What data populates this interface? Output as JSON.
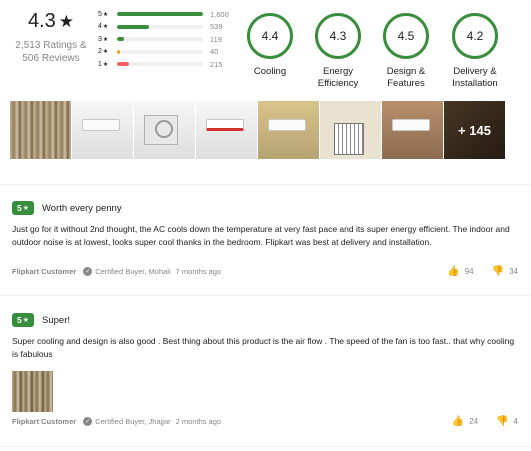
{
  "summary": {
    "average": "4.3",
    "star": "★",
    "ratings_count": "2,513 Ratings &",
    "reviews_count": "506 Reviews"
  },
  "distribution": [
    {
      "label": "5",
      "count": "1,600",
      "fraction": 1.0,
      "color": "#388e3c"
    },
    {
      "label": "4",
      "count": "539",
      "fraction": 0.37,
      "color": "#388e3c"
    },
    {
      "label": "3",
      "count": "119",
      "fraction": 0.08,
      "color": "#388e3c"
    },
    {
      "label": "2",
      "count": "40",
      "fraction": 0.03,
      "color": "#ff9f00"
    },
    {
      "label": "1",
      "count": "215",
      "fraction": 0.14,
      "color": "#ff6161"
    }
  ],
  "feature_ratings": [
    {
      "value": "4.4",
      "name_line1": "Cooling",
      "name_line2": ""
    },
    {
      "value": "4.3",
      "name_line1": "Energy",
      "name_line2": "Efficiency"
    },
    {
      "value": "4.5",
      "name_line1": "Design &",
      "name_line2": "Features"
    },
    {
      "value": "4.2",
      "name_line1": "Delivery &",
      "name_line2": "Installation"
    }
  ],
  "photos": {
    "more_label": "+ 145"
  },
  "reviews": [
    {
      "rating": "5",
      "title": "Worth every penny",
      "body": "Just go for it without 2nd thought, the AC cools down the temperature at very fast pace and its super energy efficient. The indoor and outdoor noise is at lowest, looks super cool thanks in the bedroom. Flipkart was best at delivery and installation.",
      "author": "Flipkart Customer",
      "certified": "Certified Buyer, Mohali",
      "date": "7 months ago",
      "likes": "94",
      "dislikes": "34"
    },
    {
      "rating": "5",
      "title": "Super!",
      "body": "Super cooling and design is also good . Best thing about this product is the air flow . The speed of the fan is too fast.. that why cooling is fabulous",
      "author": "Flipkart Customer",
      "certified": "Certified Buyer, Jhajjar",
      "date": "2 months ago",
      "likes": "24",
      "dislikes": "4"
    }
  ],
  "colors": {
    "accent_green": "#388e3c",
    "muted_text": "#878787"
  }
}
